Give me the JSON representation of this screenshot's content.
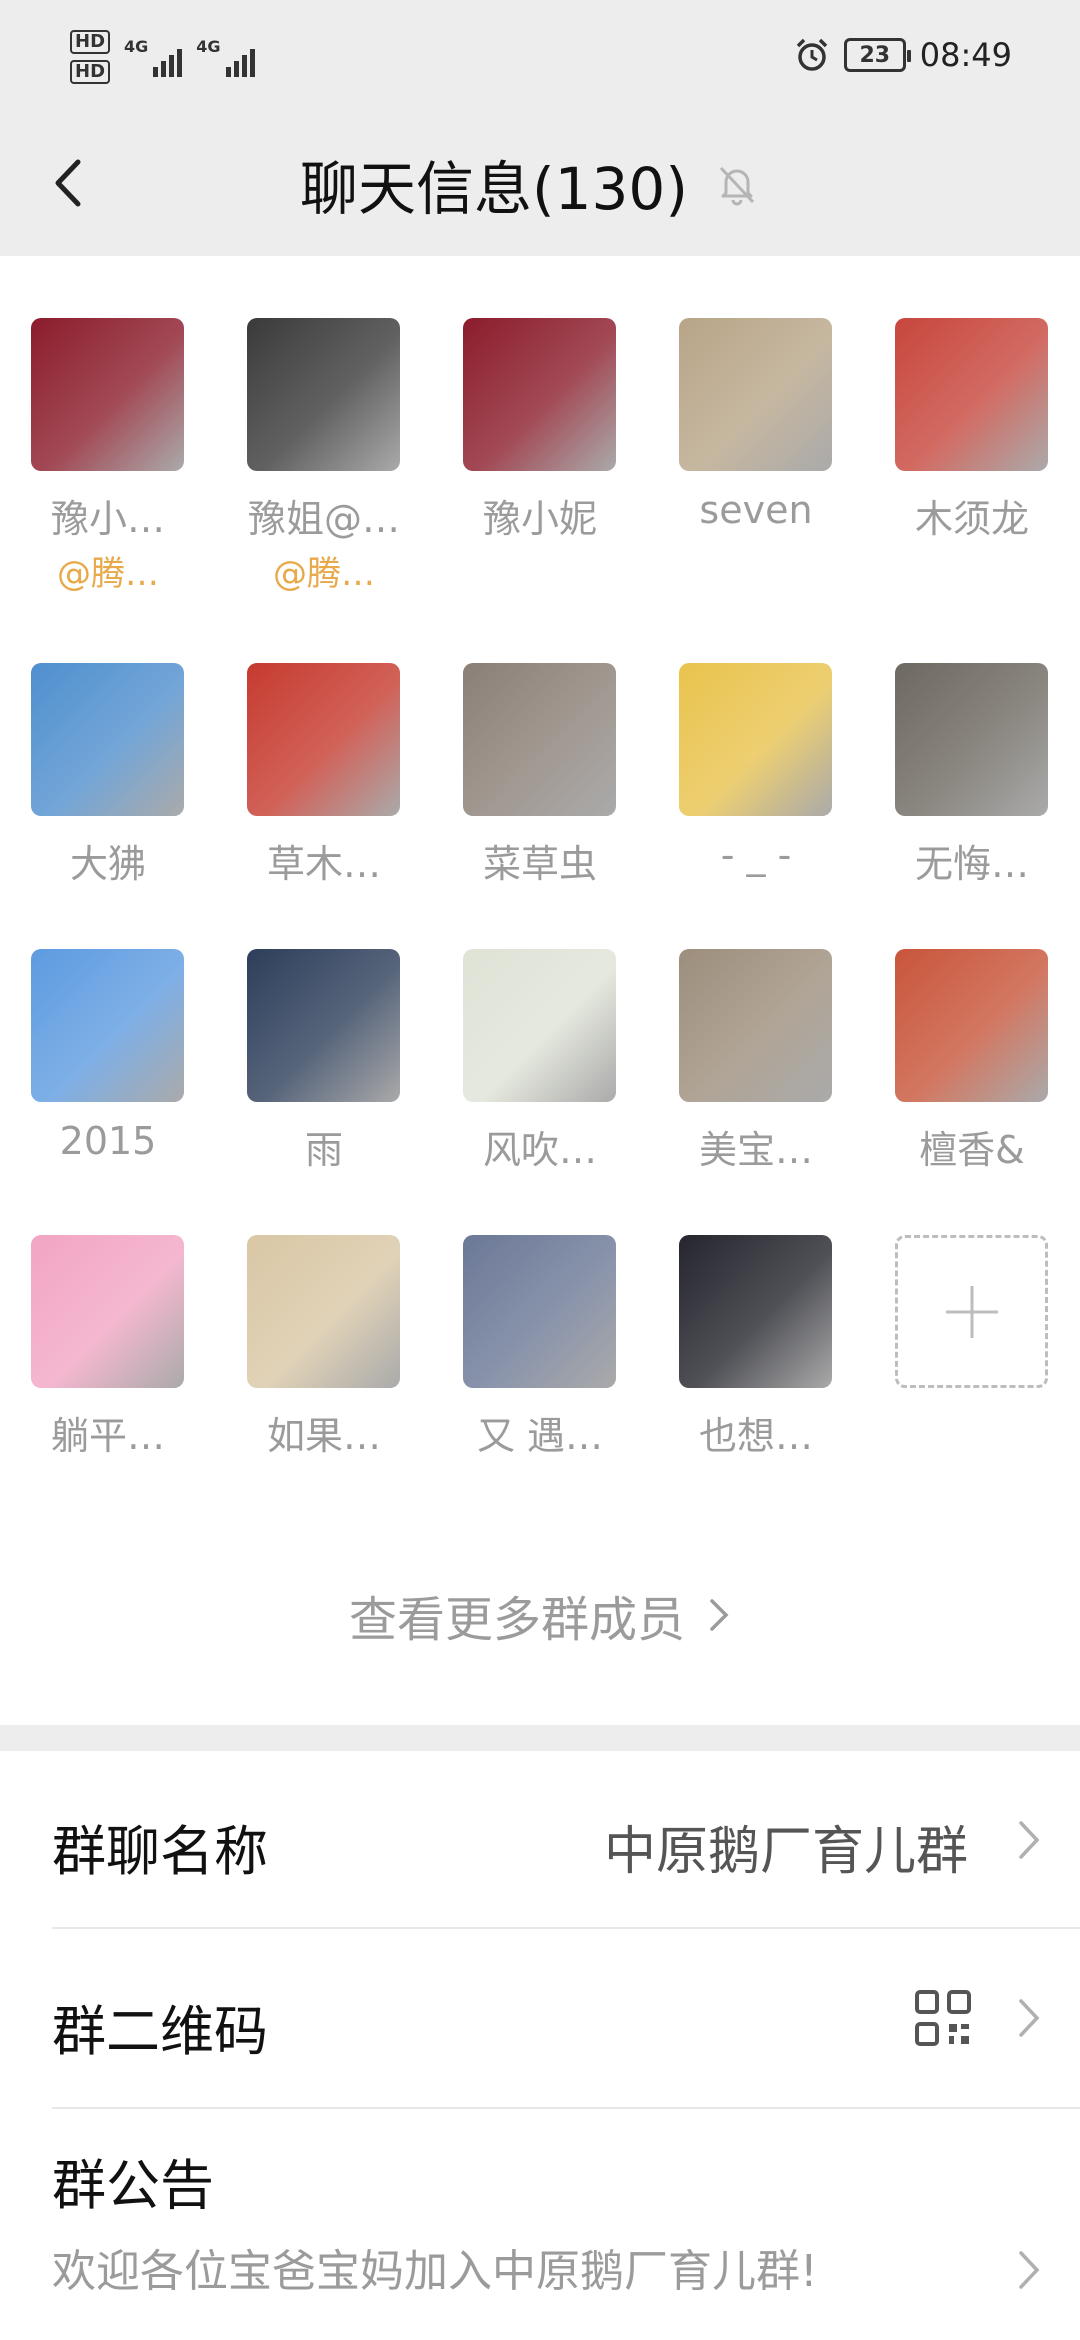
{
  "status": {
    "hd1": "HD",
    "hd2": "HD",
    "net1": "4G",
    "net2": "4G",
    "battery": "23",
    "time": "08:49"
  },
  "header": {
    "title": "聊天信息(130)"
  },
  "members": [
    {
      "name": "豫小…",
      "tag": "@腾…",
      "color": "#8b1c2b"
    },
    {
      "name": "豫姐@…",
      "tag": "@腾…",
      "color": "#3a3a3a"
    },
    {
      "name": "豫小妮",
      "tag": "",
      "color": "#8b1c2b"
    },
    {
      "name": "seven",
      "tag": "",
      "color": "#b8a588"
    },
    {
      "name": "木须龙",
      "tag": "",
      "color": "#c7463c"
    },
    {
      "name": "大狒",
      "tag": "",
      "color": "#4f8fce"
    },
    {
      "name": "草木…",
      "tag": "",
      "color": "#c63a2f"
    },
    {
      "name": "菜草虫",
      "tag": "",
      "color": "#8a7f76"
    },
    {
      "name": "- _ -",
      "tag": "",
      "color": "#e9c34d"
    },
    {
      "name": "无悔…",
      "tag": "",
      "color": "#6d6860"
    },
    {
      "name": "2015",
      "tag": "",
      "color": "#5d9be0"
    },
    {
      "name": "雨",
      "tag": "",
      "color": "#2d3e5a"
    },
    {
      "name": "风吹…",
      "tag": "",
      "color": "#dfe3d6"
    },
    {
      "name": "美宝…",
      "tag": "",
      "color": "#9d8e7c"
    },
    {
      "name": "檀香&",
      "tag": "",
      "color": "#c8553a"
    },
    {
      "name": "躺平…",
      "tag": "",
      "color": "#f2a5c3"
    },
    {
      "name": "如果…",
      "tag": "",
      "color": "#d9c7a5"
    },
    {
      "name": "又 遇…",
      "tag": "",
      "color": "#6b7896"
    },
    {
      "name": "也想…",
      "tag": "",
      "color": "#24252d"
    }
  ],
  "more_members": "查看更多群成员",
  "settings": {
    "group_name_label": "群聊名称",
    "group_name_value": "中原鹅厂育儿群",
    "qr_label": "群二维码",
    "notice_label": "群公告",
    "notice_text": "欢迎各位宝爸宝妈加入中原鹅厂育儿群!"
  }
}
